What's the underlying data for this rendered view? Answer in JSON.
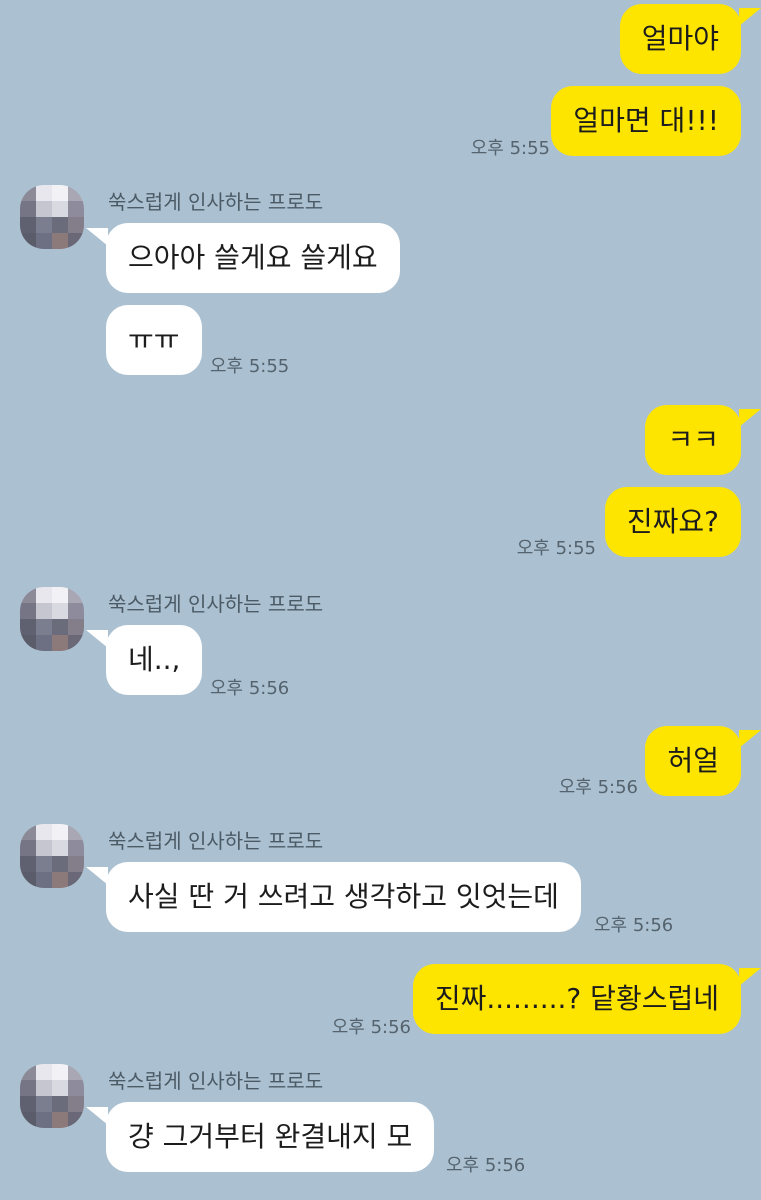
{
  "sender_name": "쑥스럽게 인사하는 프로도",
  "messages": [
    {
      "text": "얼마야"
    },
    {
      "text": "얼마면 대!!!",
      "time": "오후 5:55"
    },
    {
      "text": "으아아 쓸게요 쓸게요"
    },
    {
      "text": "ㅠㅠ",
      "time": "오후 5:55"
    },
    {
      "text": "ㅋㅋ"
    },
    {
      "text": "진짜요?",
      "time": "오후 5:55"
    },
    {
      "text": "네..,",
      "time": "오후 5:56"
    },
    {
      "text": "허얼",
      "time": "오후 5:56"
    },
    {
      "text": "사실 딴 거 쓰려고 생각하고 잇엇는데",
      "time": "오후 5:56"
    },
    {
      "text": "진짜.........? 닽황스럽네",
      "time": "오후 5:56"
    },
    {
      "text": "걍 그거부터 완결내지 모",
      "time": "오후 5:56"
    }
  ],
  "colors": {
    "background": "#abc1d1",
    "my_bubble": "#fee500",
    "other_bubble": "#ffffff"
  }
}
